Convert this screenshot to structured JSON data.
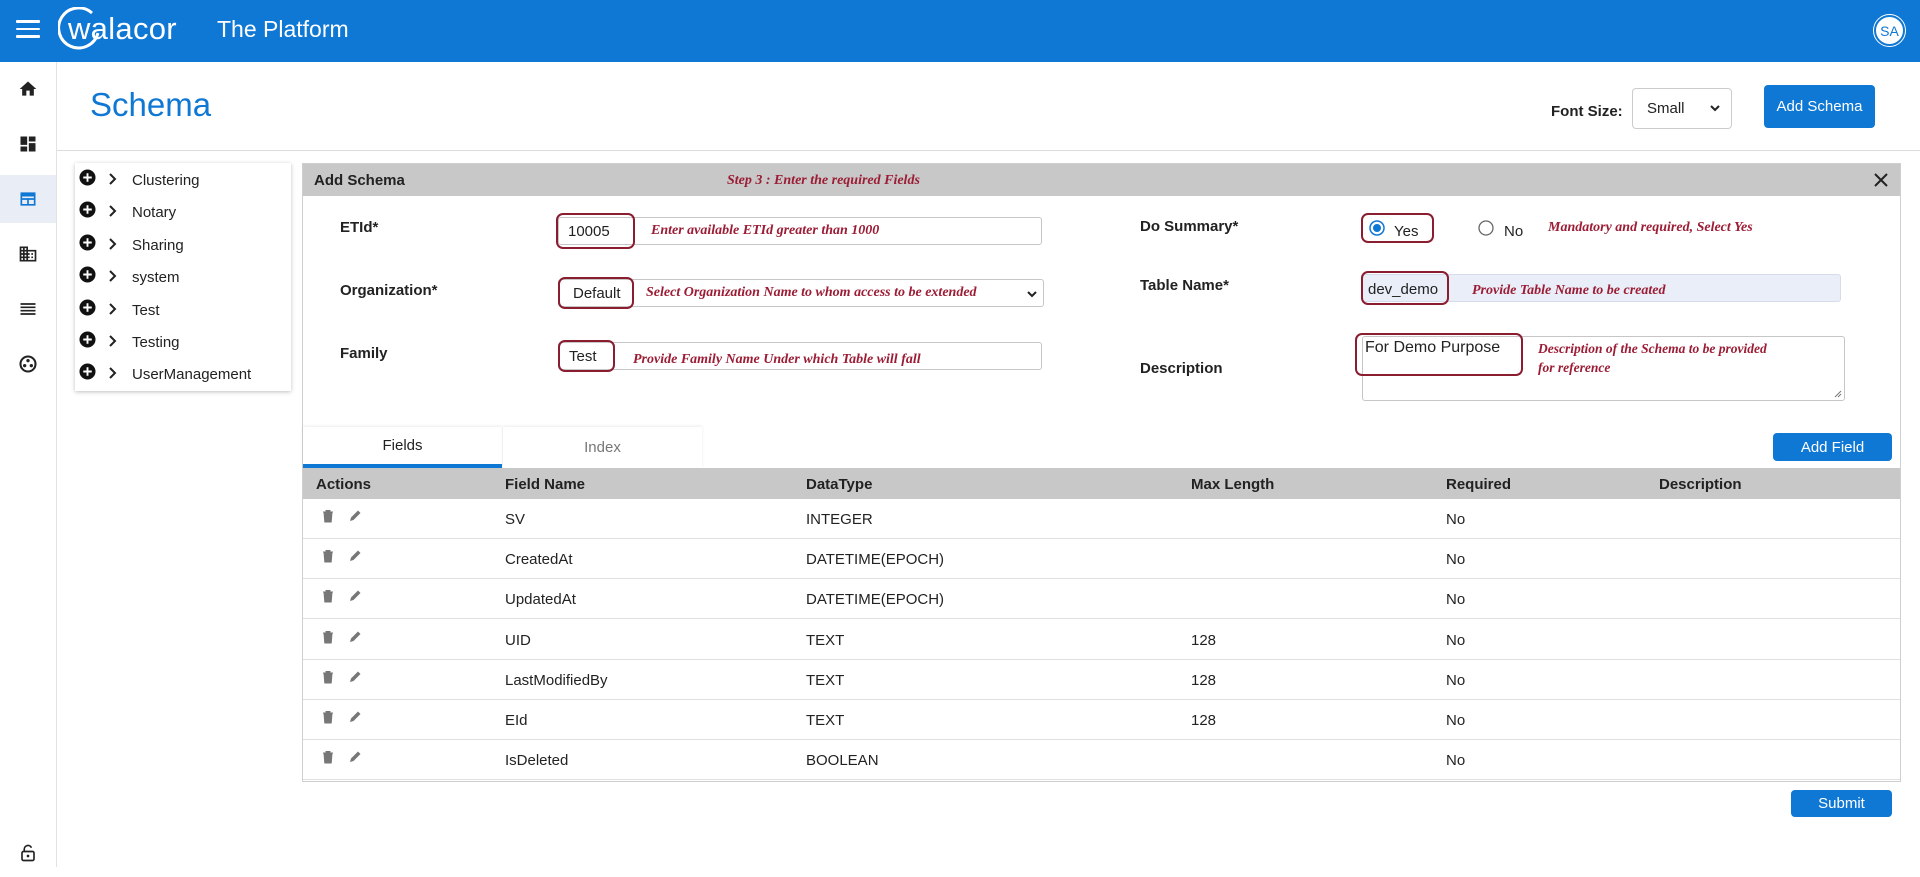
{
  "header": {
    "logo_text": "walacor",
    "app_title": "The Platform",
    "user_initials": "SA"
  },
  "colors": {
    "primary": "#0f77d4",
    "annotation": "#9b1c34",
    "highlight": "#8a1d2f",
    "table_header": "#c8c8c8"
  },
  "rail": {
    "items": [
      "home-icon",
      "dashboard-icon",
      "schema-icon",
      "organization-icon",
      "list-icon",
      "network-icon",
      "lock-icon"
    ],
    "active": "schema-icon"
  },
  "page": {
    "title": "Schema",
    "font_size_label": "Font Size:",
    "font_size_value": "Small",
    "add_schema_label": "Add Schema"
  },
  "tree": {
    "items": [
      "Clustering",
      "Notary",
      "Sharing",
      "system",
      "Test",
      "Testing",
      "UserManagement"
    ]
  },
  "panel": {
    "title": "Add Schema",
    "step_note": "Step 3 : Enter the required Fields",
    "fields": {
      "etid": {
        "label": "ETId*",
        "value": "10005",
        "note": "Enter available ETId greater than 1000"
      },
      "organization": {
        "label": "Organization*",
        "value": "Default",
        "note": "Select Organization Name to whom access to be extended"
      },
      "family": {
        "label": "Family",
        "value": "Test",
        "note": "Provide Family Name Under which Table will fall"
      },
      "do_summary": {
        "label": "Do Summary*",
        "yes": "Yes",
        "no": "No",
        "selected": "Yes",
        "note": "Mandatory and required, Select Yes"
      },
      "table_name": {
        "label": "Table Name*",
        "value": "dev_demo",
        "note": "Provide Table Name to be created"
      },
      "description": {
        "label": "Description",
        "value": "For Demo Purpose",
        "note_line1": "Description of the Schema to be provided",
        "note_line2": "for reference"
      }
    }
  },
  "tabs": {
    "fields": "Fields",
    "index": "Index",
    "active": "Fields"
  },
  "add_field_label": "Add Field",
  "submit_label": "Submit",
  "table": {
    "columns": [
      "Actions",
      "Field Name",
      "DataType",
      "Max Length",
      "Required",
      "Description"
    ],
    "rows": [
      {
        "field": "SV",
        "type": "INTEGER",
        "max": "",
        "required": "No",
        "description": ""
      },
      {
        "field": "CreatedAt",
        "type": "DATETIME(EPOCH)",
        "max": "",
        "required": "No",
        "description": ""
      },
      {
        "field": "UpdatedAt",
        "type": "DATETIME(EPOCH)",
        "max": "",
        "required": "No",
        "description": ""
      },
      {
        "field": "UID",
        "type": "TEXT",
        "max": "128",
        "required": "No",
        "description": ""
      },
      {
        "field": "LastModifiedBy",
        "type": "TEXT",
        "max": "128",
        "required": "No",
        "description": ""
      },
      {
        "field": "EId",
        "type": "TEXT",
        "max": "128",
        "required": "No",
        "description": ""
      },
      {
        "field": "IsDeleted",
        "type": "BOOLEAN",
        "max": "",
        "required": "No",
        "description": ""
      }
    ]
  }
}
